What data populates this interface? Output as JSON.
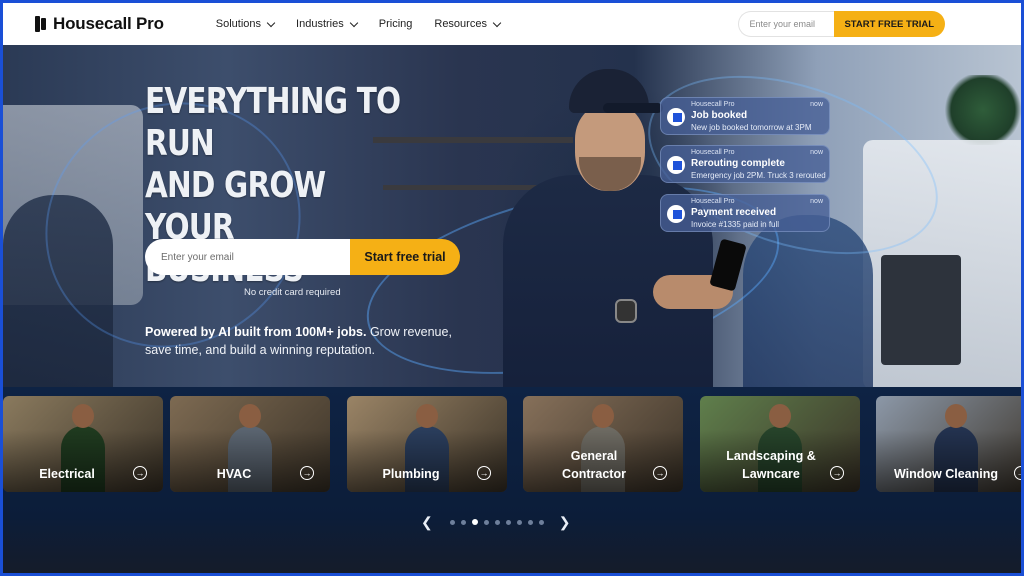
{
  "nav": {
    "logo": "Housecall Pro",
    "menu": [
      {
        "label": "Solutions",
        "dropdown": true
      },
      {
        "label": "Industries",
        "dropdown": true
      },
      {
        "label": "Pricing",
        "dropdown": false
      },
      {
        "label": "Resources",
        "dropdown": true
      }
    ],
    "email_placeholder": "Enter your email",
    "cta_label": "START FREE TRIAL"
  },
  "hero": {
    "title_lines": [
      "EVERYTHING TO RUN",
      "AND GROW YOUR",
      "BUSINESS"
    ],
    "email_placeholder": "Enter your email",
    "cta_label": "Start free trial",
    "note": "No credit card required",
    "sub_bold": "Powered by AI built from 100M+ jobs.",
    "sub_rest": " Grow revenue, save time, and build a winning reputation."
  },
  "notifications": [
    {
      "brand": "Housecall Pro",
      "time": "now",
      "title": "Job booked",
      "body": "New job booked tomorrow at 3PM"
    },
    {
      "brand": "Housecall Pro",
      "time": "now",
      "title": "Rerouting complete",
      "body": "Emergency job 2PM. Truck 3 rerouted"
    },
    {
      "brand": "Housecall Pro",
      "time": "now",
      "title": "Payment received",
      "body": "Invoice #1335 paid in full"
    }
  ],
  "categories": [
    {
      "label": "Electrical",
      "bg": "#8a7a5e",
      "shirt": "#1f3a1f"
    },
    {
      "label": "HVAC",
      "bg": "#7d6a52",
      "shirt": "#5a6470"
    },
    {
      "label": "Plumbing",
      "bg": "#9a8466",
      "shirt": "#2a3d5c"
    },
    {
      "label": "General Contractor",
      "bg": "#86705a",
      "shirt": "#6d6a62"
    },
    {
      "label": "Landscaping & Lawncare",
      "bg": "#5f7f4c",
      "shirt": "#26432a"
    },
    {
      "label": "Window Cleaning",
      "bg": "#8c98a8",
      "shirt": "#23324f"
    }
  ],
  "carousel": {
    "prev_icon": "chevron-left-icon",
    "next_icon": "chevron-right-icon",
    "dot_count": 9,
    "active_index": 2
  },
  "colors": {
    "accent": "#f5b015",
    "frame": "#1a4fd6",
    "brand_blue": "#2053d9"
  }
}
